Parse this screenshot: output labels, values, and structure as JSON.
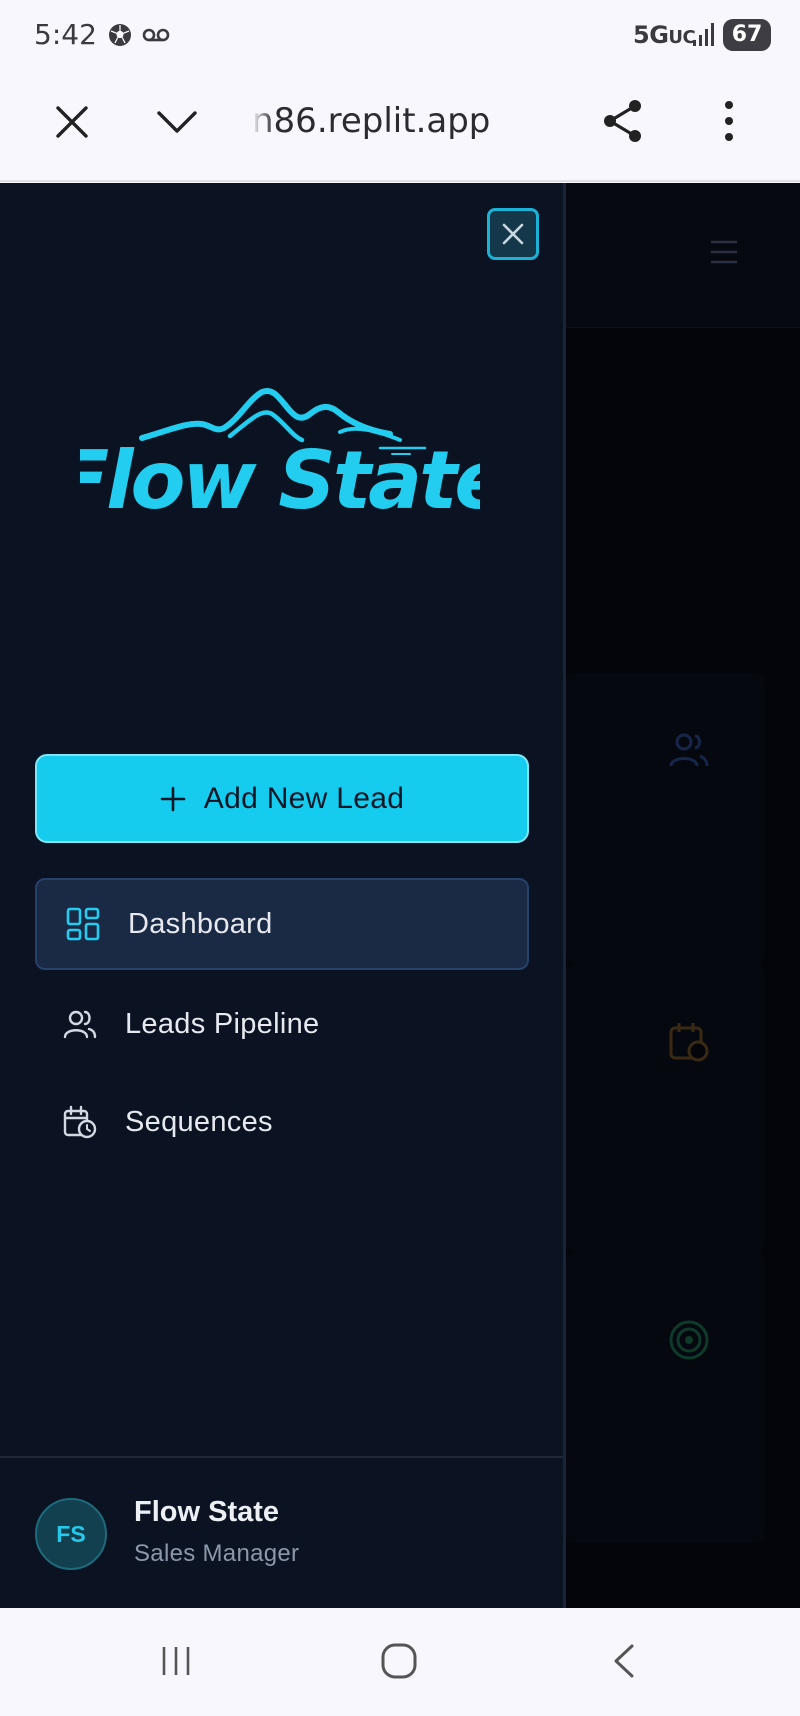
{
  "status_bar": {
    "time": "5:42",
    "network": "5G",
    "network_suffix": "UC",
    "battery": "67"
  },
  "browser": {
    "url": "n86.replit.app"
  },
  "drawer": {
    "logo_text": "Flow State",
    "add_button_label": "Add New Lead",
    "nav_items": [
      {
        "label": "Dashboard",
        "icon": "dashboard-icon",
        "active": true
      },
      {
        "label": "Leads Pipeline",
        "icon": "users-icon",
        "active": false
      },
      {
        "label": "Sequences",
        "icon": "calendar-clock-icon",
        "active": false
      }
    ],
    "user": {
      "initials": "FS",
      "name": "Flow State",
      "role": "Sales Manager"
    }
  },
  "colors": {
    "accent": "#15ccef",
    "drawer_bg": "#0b1322",
    "active_item_bg": "#1a2a45",
    "logo": "#22cdef"
  }
}
